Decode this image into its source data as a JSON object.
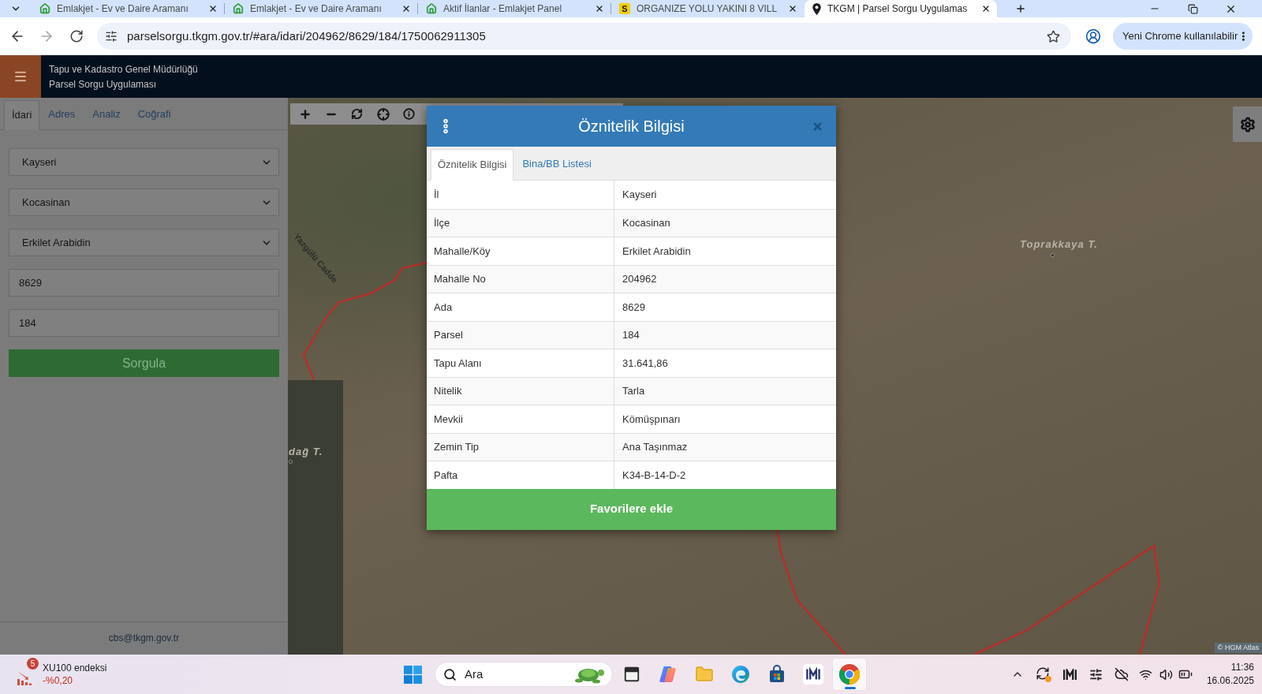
{
  "browser": {
    "tabs": [
      {
        "kind": "house",
        "title": "Emlakjet - Ev ve Daire Aramanı",
        "selected": false
      },
      {
        "kind": "house",
        "title": "Emlakjet - Ev ve Daire Aramanı",
        "selected": false
      },
      {
        "kind": "house",
        "title": "Aktif İlanlar - Emlakjet Panel",
        "selected": false
      },
      {
        "kind": "letter",
        "letter": "S",
        "title": "ORGANIZE YOLU YAKINI 8 VILL",
        "selected": false
      },
      {
        "kind": "pin",
        "title": "TKGM | Parsel Sorgu Uygulamas",
        "selected": true
      }
    ],
    "url": "parselsorgu.tkgm.gov.tr/#ara/idari/204962/8629/184/1750062911305",
    "update_button": "Yeni Chrome kullanılabilir"
  },
  "app_header": {
    "title": "Tapu ve Kadastro Genel Müdürlüğü",
    "subtitle": "Parsel Sorgu Uygulaması"
  },
  "sidebar": {
    "tabs": [
      {
        "label": "İdari",
        "selected": true
      },
      {
        "label": "Adres",
        "selected": false
      },
      {
        "label": "Analiz",
        "selected": false
      },
      {
        "label": "Coğrafi",
        "selected": false
      }
    ],
    "fields": [
      {
        "kind": "select",
        "value": "Kayseri"
      },
      {
        "kind": "select",
        "value": "Kocasinan"
      },
      {
        "kind": "select",
        "value": "Erkilet Arabidin"
      },
      {
        "kind": "input",
        "value": "8629"
      },
      {
        "kind": "input",
        "value": "184"
      }
    ],
    "query_button": "Sorgula",
    "footer_email": "cbs@tkgm.gov.tr"
  },
  "map": {
    "labels": [
      {
        "kind": "road",
        "text": "Yazgülü Cadde"
      },
      {
        "kind": "peak",
        "text": "Toprakkaya T."
      },
      {
        "kind": "peak",
        "text": "dağ T."
      }
    ],
    "attribution": "© HGM Atlas"
  },
  "dialog": {
    "title": "Öznitelik Bilgisi",
    "tabs": [
      {
        "label": "Öznitelik Bilgisi",
        "selected": true
      },
      {
        "label": "Bina/BB Listesi",
        "selected": false
      }
    ],
    "rows": [
      {
        "label": "İl",
        "value": "Kayseri"
      },
      {
        "label": "İlçe",
        "value": "Kocasinan"
      },
      {
        "label": "Mahalle/Köy",
        "value": "Erkilet Arabidin"
      },
      {
        "label": "Mahalle No",
        "value": "204962"
      },
      {
        "label": "Ada",
        "value": "8629"
      },
      {
        "label": "Parsel",
        "value": "184"
      },
      {
        "label": "Tapu Alanı",
        "value": "31.641,86"
      },
      {
        "label": "Nitelik",
        "value": "Tarla"
      },
      {
        "label": "Mevkii",
        "value": "Kömüşpınarı"
      },
      {
        "label": "Zemin Tip",
        "value": "Ana Taşınmaz"
      },
      {
        "label": "Pafta",
        "value": "K34-B-14-D-2"
      }
    ],
    "button": "Favorilere ekle"
  },
  "taskbar": {
    "widget": {
      "badge": "5",
      "title": "XU100 endeksi",
      "reading": "-%0,20"
    },
    "search_button": "Ara",
    "apps": [
      {
        "kind": "document",
        "active": false
      },
      {
        "kind": "swirl",
        "active": false
      },
      {
        "kind": "folder",
        "active": false
      },
      {
        "kind": "wave",
        "active": false
      },
      {
        "kind": "bag",
        "active": false
      },
      {
        "kind": "m-logo",
        "active": false
      },
      {
        "kind": "tricolor",
        "active": true
      }
    ],
    "clock": {
      "time": "11:36",
      "date": "16.06.2025"
    }
  }
}
